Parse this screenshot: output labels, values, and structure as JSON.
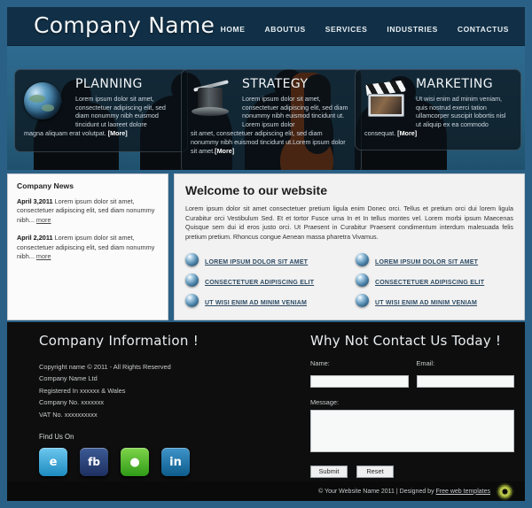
{
  "header": {
    "logo": "Company Name",
    "nav": [
      {
        "label": "HOME"
      },
      {
        "label": "ABOUTUS"
      },
      {
        "label": "SERVICES"
      },
      {
        "label": "INDUSTRIES"
      },
      {
        "label": "CONTACTUS"
      }
    ]
  },
  "banner": {
    "features": [
      {
        "icon": "globe-icon",
        "title": "PLANNING",
        "body": "Lorem ipsum dolor sit amet, consectetuer adipiscing elit, sed diam nonummy nibh euismod tincidunt ut laoreet dolore",
        "overflow": "magna aliquam erat volutpat.",
        "more": "[More]"
      },
      {
        "icon": "magic-hat-icon",
        "title": "STRATEGY",
        "body": "Lorem ipsum dolor sit amet, consectetuer adipiscing elit, sed diam nonummy nibh euismod tincidunt ut. Lorem ipsum dolor",
        "overflow": "sit amet, consectetuer adipiscing elit, sed diam nonummy nibh euismod tincidunt ut.Lorem ipsum dolor sit amet.",
        "more": "[More]"
      },
      {
        "icon": "clapperboard-icon",
        "title": "MARKETING",
        "body": "Ut wisi enim ad minim veniam, quis nostrud exerci tation ullamcorper suscipit lobortis nisl ut aliquip ex ea commodo",
        "overflow": "consequat.",
        "more": "[More]"
      }
    ]
  },
  "news": {
    "title": "Company News",
    "items": [
      {
        "date": "April 3,2011",
        "text": "Lorem ipsum dolor sit amet, consectetuer adipiscing elit, sed diam nonummy nibh...",
        "more": "more"
      },
      {
        "date": "April 2,2011",
        "text": "Lorem ipsum dolor sit amet, consectetuer adipiscing elit, sed diam nonummy nibh...",
        "more": "more"
      }
    ]
  },
  "welcome": {
    "title": "Welcome to our website",
    "intro": "Lorem ipsum dolor sit amet consectetuer pretium ligula enim Donec orci. Tellus et pretium orci dui lorem ligula Curabitur orci Vestibulum Sed. Et et tortor Fusce urna In et In tellus montes vel. Lorem morbi ipsum Maecenas Quisque sem dui id eros justo orci. Ut Praesent in Curabitur Praesent condimentum interdum malesuada felis pretium pretium. Rhoncus congue Aenean massa pharetra Vivamus.",
    "link_columns": [
      {
        "links": [
          {
            "label": "LOREM IPSUM DOLOR SIT AMET"
          },
          {
            "label": "CONSECTETUER ADIPISCING ELIT"
          },
          {
            "label": "UT WISI ENIM AD MINIM VENIAM"
          }
        ]
      },
      {
        "links": [
          {
            "label": "LOREM IPSUM DOLOR SIT AMET"
          },
          {
            "label": "CONSECTETUER ADIPISCING ELIT"
          },
          {
            "label": "UT WISI ENIM AD MINIM VENIAM"
          }
        ]
      }
    ]
  },
  "footer_info": {
    "title": "Company Information !",
    "lines": [
      "Copyright name © 2011 - All Rights Reserved",
      "Company Name Ltd",
      "Registered In xxxxxx & Wales",
      "Company No. xxxxxxx",
      "VAT No. xxxxxxxxxx"
    ],
    "find_us_label": "Find Us On",
    "socials": [
      {
        "name": "twitter",
        "glyph": "e"
      },
      {
        "name": "facebook",
        "glyph": "fb"
      },
      {
        "name": "technorati",
        "glyph": "●"
      },
      {
        "name": "linkedin",
        "glyph": "in"
      }
    ]
  },
  "contact": {
    "title": "Why Not Contact Us Today !",
    "name_label": "Name:",
    "name_value": "",
    "email_label": "Email:",
    "email_value": "",
    "message_label": "Message:",
    "message_value": "",
    "submit_label": "Submit",
    "reset_label": "Reset"
  },
  "bottom": {
    "copyright": "© Your Website Name 2011 | Designed by ",
    "designer_link": "Free web templates"
  },
  "colors": {
    "page_border": "#2a6086",
    "header_bg": "#113047",
    "banner_top": "#2e6a90",
    "accent_orange": "#e8590c",
    "footer_bg": "#0e0e0e",
    "panel_bg": "#f2f2f2"
  }
}
